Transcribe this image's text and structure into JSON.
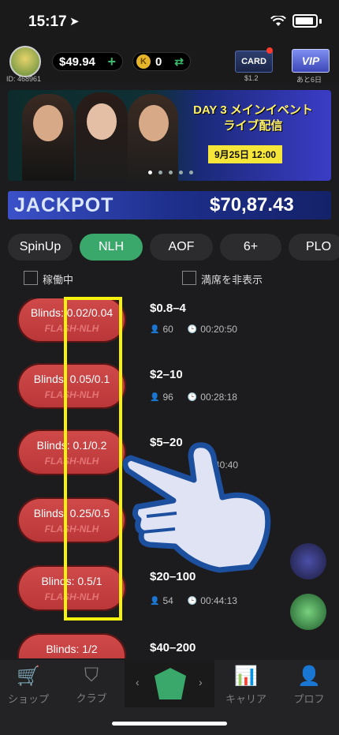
{
  "status": {
    "time": "15:17"
  },
  "header": {
    "user_id": "ID: 468961",
    "balance": "$49.94",
    "balance_add": "+",
    "coins": "0",
    "coin_symbol": "K",
    "swap": "⇄",
    "card_label": "CARD",
    "card_sub": "$1.2",
    "vip_label": "VIP",
    "vip_sub": "あと6日"
  },
  "banner": {
    "title_line1": "DAY 3 メインイベント",
    "title_line2": "ライブ配信",
    "date": "9月25日 12:00"
  },
  "jackpot": {
    "label": "JACKPOT",
    "amount": "$70,87.43"
  },
  "tabs": [
    {
      "label": "SpinUp",
      "active": false
    },
    {
      "label": "NLH",
      "active": true
    },
    {
      "label": "AOF",
      "active": false
    },
    {
      "label": "6+",
      "active": false
    },
    {
      "label": "PLO",
      "active": false
    }
  ],
  "filters": {
    "active_only": "稼働中",
    "hide_full": "満席を非表示"
  },
  "tables": [
    {
      "blinds": "Blinds: 0.02/0.04",
      "type": "FLASH-NLH",
      "stakes": "$0.8–4",
      "players": "60",
      "time": "00:20:50"
    },
    {
      "blinds": "Blinds: 0.05/0.1",
      "type": "FLASH-NLH",
      "stakes": "$2–10",
      "players": "96",
      "time": "00:28:18"
    },
    {
      "blinds": "Blinds: 0.1/0.2",
      "type": "FLASH-NLH",
      "stakes": "$5–20",
      "players": "",
      "time": "40:40"
    },
    {
      "blinds": "Blinds: 0.25/0.5",
      "type": "FLASH-NLH",
      "stakes": "",
      "players": "",
      "time": ""
    },
    {
      "blinds": "Blinds: 0.5/1",
      "type": "FLASH-NLH",
      "stakes": "$20–100",
      "players": "54",
      "time": "00:44:13"
    },
    {
      "blinds": "Blinds: 1/2",
      "type": "",
      "stakes": "$40–200",
      "players": "",
      "time": ""
    }
  ],
  "bottom_nav": [
    {
      "label": "ショップ",
      "icon": "cart-icon"
    },
    {
      "label": "クラブ",
      "icon": "shield-icon"
    },
    {
      "label": "キャリア",
      "icon": "chart-icon"
    },
    {
      "label": "プロフ",
      "icon": "person-icon"
    }
  ],
  "colors": {
    "accent": "#3aa86b",
    "button_red": "#c94040",
    "highlight": "#f4f20e"
  }
}
